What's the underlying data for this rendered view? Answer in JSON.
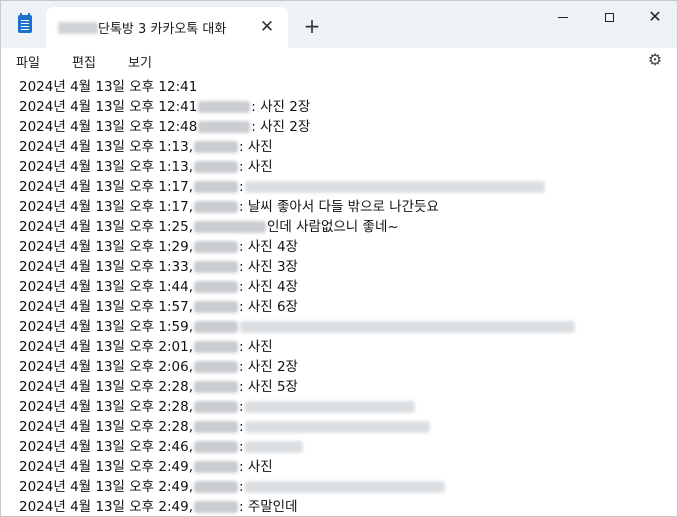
{
  "window": {
    "tab_title": "단톡방 3 카카오톡 대화",
    "tab_close": "✕",
    "new_tab": "+",
    "minimize": "",
    "maximize": "",
    "close": "✕"
  },
  "menu": {
    "file": "파일",
    "edit": "편집",
    "view": "보기",
    "settings_icon": "gear-icon"
  },
  "lines": [
    {
      "ts": "2024년 4월 13일 오후 12:41",
      "msg": ""
    },
    {
      "ts": "2024년 4월 13일 오후 12:41",
      "msg": " : 사진 2장"
    },
    {
      "ts": "2024년 4월 13일 오후 12:48",
      "msg": " : 사진 2장"
    },
    {
      "ts": "2024년 4월 13일 오후 1:13,",
      "msg": " : 사진"
    },
    {
      "ts": "2024년 4월 13일 오후 1:13,",
      "msg": " : 사진"
    },
    {
      "ts": "2024년 4월 13일 오후 1:17,",
      "msg": " :"
    },
    {
      "ts": "2024년 4월 13일 오후 1:17,",
      "msg": " : 날씨 좋아서 다들 밖으로 나간듯요"
    },
    {
      "ts": "2024년 4월 13일 오후 1:25,",
      "msg": "인데 사람없으니 좋네~"
    },
    {
      "ts": "2024년 4월 13일 오후 1:29,",
      "msg": " : 사진 4장"
    },
    {
      "ts": "2024년 4월 13일 오후 1:33,",
      "msg": " : 사진 3장"
    },
    {
      "ts": "2024년 4월 13일 오후 1:44,",
      "msg": " : 사진 4장"
    },
    {
      "ts": "2024년 4월 13일 오후 1:57,",
      "msg": " : 사진 6장"
    },
    {
      "ts": "2024년 4월 13일 오후 1:59,",
      "msg": ""
    },
    {
      "ts": "2024년 4월 13일 오후 2:01,",
      "msg": " : 사진"
    },
    {
      "ts": "2024년 4월 13일 오후 2:06,",
      "msg": " : 사진 2장"
    },
    {
      "ts": "2024년 4월 13일 오후 2:28,",
      "msg": " : 사진 5장"
    },
    {
      "ts": "2024년 4월 13일 오후 2:28,",
      "msg": " :"
    },
    {
      "ts": "2024년 4월 13일 오후 2:28,",
      "msg": " :"
    },
    {
      "ts": "2024년 4월 13일 오후 2:46,",
      "msg": " :"
    },
    {
      "ts": "2024년 4월 13일 오후 2:49,",
      "msg": " : 사진"
    },
    {
      "ts": "2024년 4월 13일 오후 2:49,",
      "msg": " :"
    },
    {
      "ts": "2024년 4월 13일 오후 2:49,",
      "msg": " : 주말인데"
    }
  ]
}
